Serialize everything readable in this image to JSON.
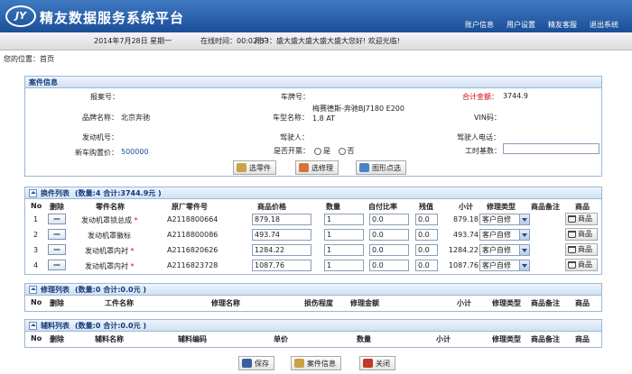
{
  "header": {
    "logo": "JY",
    "title": "精友数据服务系统平台",
    "nav": [
      "账户信息",
      "用户设置",
      "精友客服",
      "退出系统"
    ]
  },
  "infobar": {
    "date": "2014年7月28日 星期一",
    "online": "在线时间：00:02:53",
    "user": "用户：盛大盛大盛大盛大盛大您好! 欢迎光临!"
  },
  "breadcrumb": "您的位置：首页",
  "case": {
    "title": "案件信息",
    "labels": {
      "report": "报案号：",
      "plate": "车牌号：",
      "total": "合计金额：",
      "brand": "品牌名称：",
      "model": "车型名称：",
      "vin": "VIN码：",
      "engine": "发动机号：",
      "driver": "驾驶人：",
      "driver_phone": "驾驶人电话：",
      "price": "新车购置价：",
      "invoice": "是否开票：",
      "hours": "工时基数："
    },
    "values": {
      "total": "3744.9",
      "brand": "北京奔驰",
      "model": "梅赛德斯-奔驰BJ7180 E200 1.8 AT",
      "price": "500000",
      "yes": "是",
      "no": "否"
    },
    "buttons": {
      "parts": "选零件",
      "repair": "选修理",
      "graphic": "图形点选"
    }
  },
  "parts": {
    "title": "换件列表",
    "summary": "(数量:4  合计:3744.9元 )",
    "headers": [
      "No",
      "删除",
      "零件名称",
      "原厂零件号",
      "商品价格",
      "数量",
      "自付比率",
      "残值",
      "小计",
      "修理类型",
      "商品备注",
      "商品"
    ],
    "rows": [
      {
        "no": "1",
        "name": "发动机罩锁总成",
        "star": "*",
        "oem": "A2118800664",
        "price": "879.18",
        "qty": "1",
        "ratio": "0.0",
        "salvage": "0.0",
        "subtotal": "879.18",
        "type": "客户自修",
        "goods": "商品"
      },
      {
        "no": "2",
        "name": "发动机罩徽标",
        "star": "",
        "oem": "A2118800086",
        "price": "493.74",
        "qty": "1",
        "ratio": "0.0",
        "salvage": "0.0",
        "subtotal": "493.74",
        "type": "客户自修",
        "goods": "商品"
      },
      {
        "no": "3",
        "name": "发动机罩内衬",
        "star": "*",
        "oem": "A2116820626",
        "price": "1284.22",
        "qty": "1",
        "ratio": "0.0",
        "salvage": "0.0",
        "subtotal": "1284.22",
        "type": "客户自修",
        "goods": "商品"
      },
      {
        "no": "4",
        "name": "发动机罩内衬",
        "star": "*",
        "oem": "A2116823728",
        "price": "1087.76",
        "qty": "1",
        "ratio": "0.0",
        "salvage": "0.0",
        "subtotal": "1087.76",
        "type": "客户自修",
        "goods": "商品"
      }
    ]
  },
  "repair": {
    "title": "修理列表",
    "summary": "(数量:0  合计:0.0元 )",
    "headers": [
      "No",
      "删除",
      "工件名称",
      "修理名称",
      "损伤程度",
      "修理金额",
      "小计",
      "修理类型",
      "商品备注",
      "商品"
    ]
  },
  "aux": {
    "title": "辅料列表",
    "summary": "(数量:0  合计:0.0元 )",
    "headers": [
      "No",
      "删除",
      "辅料名称",
      "辅料编码",
      "单价",
      "数量",
      "小计",
      "修理类型",
      "商品备注",
      "商品"
    ]
  },
  "footer": {
    "save": "保存",
    "case_info": "案件信息",
    "close": "关闭"
  },
  "colors": {
    "header": "#1b4f98",
    "panel_border": "#9cb7d8",
    "accent_red": "#cc0000"
  }
}
